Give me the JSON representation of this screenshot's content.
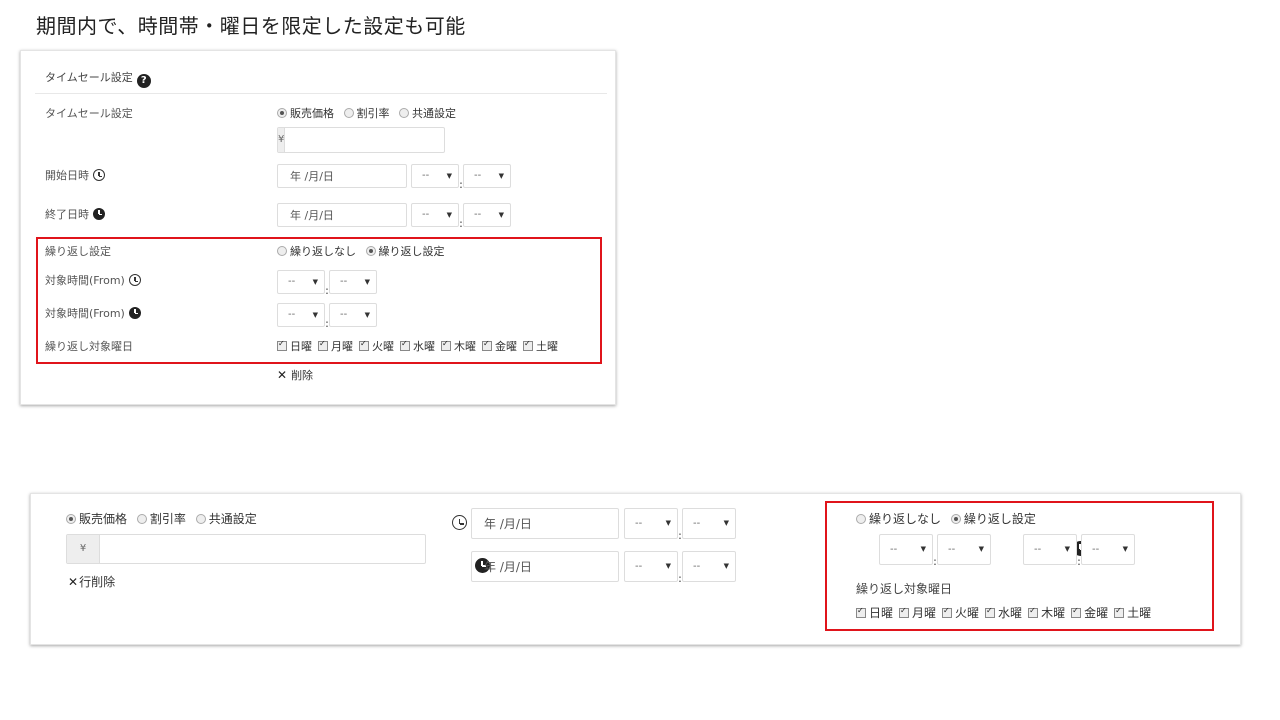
{
  "heading": "期間内で、時間帯・曜日を限定した設定も可能",
  "colors": {
    "highlight": "#e0141b"
  },
  "top_card": {
    "title": "タイムセール設定",
    "help_icon": "question-circle-icon",
    "rows": {
      "timesale_label": "タイムセール設定",
      "start_label": "開始日時",
      "end_label": "終了日時",
      "repeat_label": "繰り返し設定",
      "from_label_1": "対象時間(From)",
      "from_label_2": "対象時間(From)",
      "weekday_label": "繰り返し対象曜日"
    },
    "price_options": [
      "販売価格",
      "割引率",
      "共通設定"
    ],
    "price_selected": "販売価格",
    "currency_addon": "¥",
    "date_placeholder": "年 /月/日",
    "select_value": "--",
    "repeat_options": [
      "繰り返しなし",
      "繰り返し設定"
    ],
    "repeat_selected": "繰り返し設定",
    "days": [
      "日曜",
      "月曜",
      "火曜",
      "水曜",
      "木曜",
      "金曜",
      "土曜"
    ],
    "delete_label": "削除"
  },
  "bottom_card": {
    "price_options": [
      "販売価格",
      "割引率",
      "共通設定"
    ],
    "price_selected": "販売価格",
    "currency_addon": "¥",
    "delete_row_label": "行削除",
    "date_placeholder": "年 /月/日",
    "select_value": "--",
    "repeat_options": [
      "繰り返しなし",
      "繰り返し設定"
    ],
    "repeat_selected": "繰り返し設定",
    "weekday_label": "繰り返し対象曜日",
    "days": [
      "日曜",
      "月曜",
      "火曜",
      "水曜",
      "木曜",
      "金曜",
      "土曜"
    ]
  }
}
